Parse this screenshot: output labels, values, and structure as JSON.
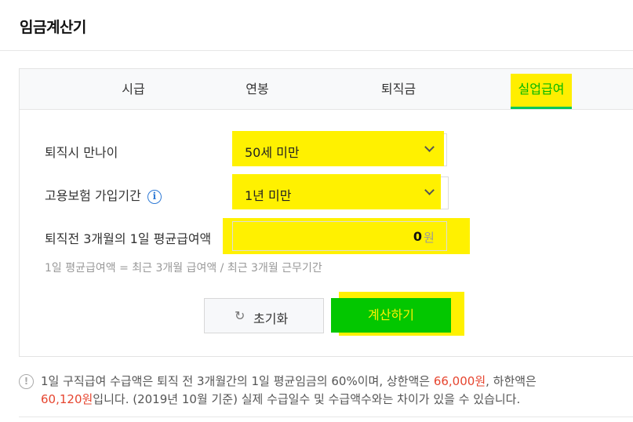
{
  "header": {
    "title": "임금계산기"
  },
  "tabs": [
    {
      "label": "시급",
      "active": false
    },
    {
      "label": "연봉",
      "active": false
    },
    {
      "label": "퇴직금",
      "active": false
    },
    {
      "label": "실업급여",
      "active": true
    }
  ],
  "form": {
    "age": {
      "label": "퇴직시 만나이",
      "value": "50세 미만"
    },
    "insurance": {
      "label": "고용보험 가입기간",
      "value": "1년 미만",
      "info_icon": "info-icon"
    },
    "wage": {
      "label": "퇴직전 3개월의 1일 평균급여액",
      "value": "0",
      "unit": "원"
    },
    "formula": "1일 평균급여액 = 최근 3개월 급여액 / 최근 3개월 근무기간"
  },
  "buttons": {
    "reset": "초기화",
    "reset_icon": "refresh-icon",
    "calculate": "계산하기"
  },
  "notice": {
    "line1_a": "1일 구직급여 수급액은 퇴직 전 3개월간의 1일 평균임금의 60%이며, 상한액은 ",
    "upper": "66,000원",
    "line1_b": ", 하한액은",
    "lower": "60,120원",
    "line2_b": "입니다. (2019년 10월 기준) 실제 수급일수 및 수급액수와는 차이가 있을 수 있습니다."
  },
  "colors": {
    "accent_green": "#03c700",
    "highlight": "#fff100",
    "limit_red": "#e6452f",
    "info_blue": "#2f7ad6"
  }
}
